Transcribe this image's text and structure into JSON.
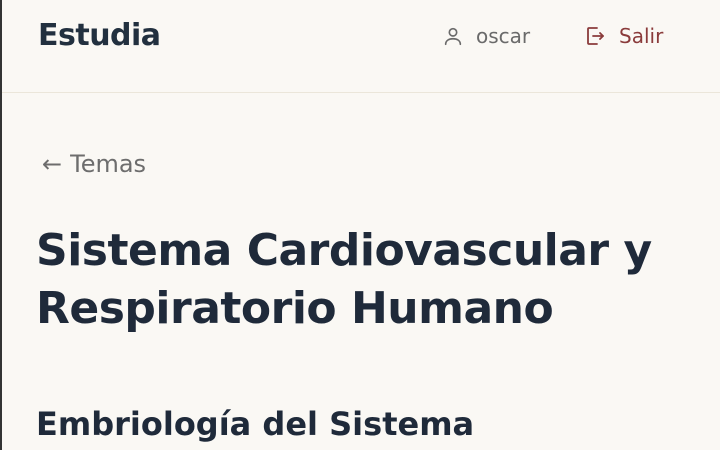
{
  "header": {
    "brand": "Estudia",
    "user_name": "oscar",
    "logout_label": "Salir"
  },
  "icons": {
    "user": "user-icon",
    "logout": "logout-icon",
    "back": "arrow-left-icon"
  },
  "colors": {
    "background": "#faf8f4",
    "text": "#1f2a3a",
    "muted": "#6d6d6d",
    "logout": "#8a3b3b"
  },
  "nav": {
    "back_label": "Temas",
    "back_arrow": "←"
  },
  "main": {
    "title": "Sistema Cardiovascular y Respiratorio Humano",
    "section_title": "Embriología del Sistema"
  }
}
